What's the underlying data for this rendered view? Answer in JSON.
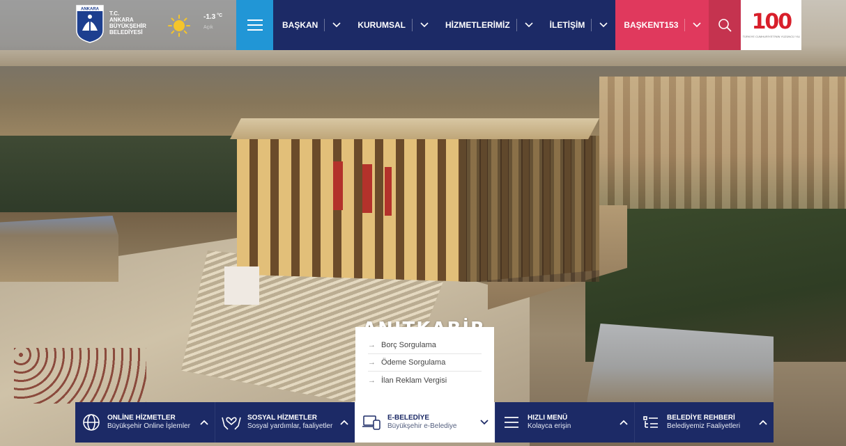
{
  "brand": {
    "emblem_label": "ANKARA",
    "line1": "T.C.",
    "line2": "ANKARA",
    "line3": "BÜYÜKŞEHİR",
    "line4": "BELEDİYESİ"
  },
  "weather": {
    "icon": "sun-icon",
    "temperature": "-1.3",
    "unit": "°C",
    "description": "Açık"
  },
  "nav": {
    "menu_icon": "hamburger-icon",
    "items": [
      {
        "label": "BAŞKAN"
      },
      {
        "label": "KURUMSAL"
      },
      {
        "label": "HİZMETLERİMİZ"
      },
      {
        "label": "İLETİŞİM"
      }
    ],
    "accent_item": {
      "label": "BAŞKENT153"
    },
    "search_icon": "search-icon",
    "badge": {
      "number": "100",
      "caption": "TÜRKİYE CUMHURİYETİ'NİN YÜZÜNCÜ YILI"
    }
  },
  "hero": {
    "caption": "ANITKABİR"
  },
  "ebelediye_dropdown": {
    "items": [
      {
        "label": "Borç Sorgulama"
      },
      {
        "label": "Ödeme Sorgulama"
      },
      {
        "label": "İlan Reklam Vergisi"
      }
    ]
  },
  "bottom_bar": {
    "tiles": [
      {
        "title": "ONLİNE HİZMETLER",
        "subtitle": "Büyükşehir Online İşlemler",
        "icon": "globe-icon",
        "chevron": "chevron-up-icon"
      },
      {
        "title": "SOSYAL HİZMETLER",
        "subtitle": "Sosyal yardımlar, faaliyetler",
        "icon": "hands-heart-icon",
        "chevron": "chevron-up-icon"
      },
      {
        "title": "E-BELEDİYE",
        "subtitle": "Büyükşehir e-Belediye",
        "icon": "devices-icon",
        "chevron": "chevron-down-icon"
      },
      {
        "title": "HIZLI MENÜ",
        "subtitle": "Kolayca erişin",
        "icon": "menu-icon",
        "chevron": "chevron-up-icon"
      },
      {
        "title": "BELEDİYE REHBERİ",
        "subtitle": "Belediyemiz Faaliyetleri",
        "icon": "list-icon",
        "chevron": "chevron-up-icon"
      }
    ]
  },
  "colors": {
    "navy": "#1c2a66",
    "blue": "#2196d6",
    "pink": "#e0395d",
    "white": "#ffffff",
    "badge_red": "#d81f2b"
  }
}
